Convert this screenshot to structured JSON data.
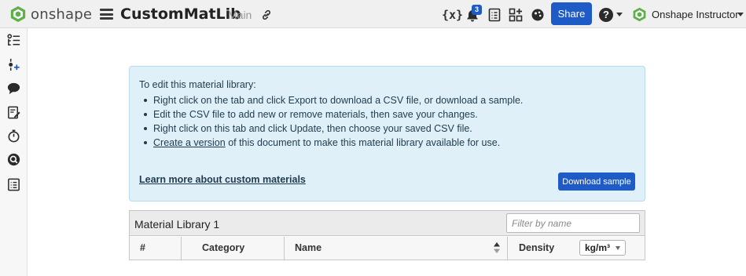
{
  "header": {
    "brand": "onshape",
    "document_title": "CustomMatLib",
    "branch": "Main",
    "variables_label": "{x}",
    "notification_count": "3",
    "share_label": "Share",
    "help_label": "?",
    "user_name": "Onshape Instructor",
    "icons": [
      "onshape-logo-icon",
      "hamburger-menu-icon",
      "link-icon",
      "variables-icon",
      "bell-icon",
      "tasks-icon",
      "app-store-icon",
      "graphics-icon",
      "help-icon",
      "caret-down-icon"
    ]
  },
  "sidebar": {
    "icons": [
      "features-list-icon",
      "insert-feature-icon",
      "comments-icon",
      "notes-icon",
      "timer-icon",
      "search-icon",
      "list-icon"
    ]
  },
  "info": {
    "heading": "To edit this material library:",
    "bullets": [
      "Right click on the tab and click Export to download a CSV file, or download a sample.",
      "Edit the CSV file to add new or remove materials, then save your changes.",
      "Right click on this tab and click Update, then choose your saved CSV file."
    ],
    "last_bullet_link": "Create a version",
    "last_bullet_rest": " of this document to make this material library available for use.",
    "learn_more": "Learn more about custom materials",
    "download_button": "Download sample"
  },
  "table": {
    "title": "Material Library 1",
    "filter_placeholder": "Filter by name",
    "columns": [
      "#",
      "Category",
      "Name",
      "Density"
    ],
    "density_unit": "kg/m³"
  },
  "colors": {
    "accent": "#1e5bc6",
    "info_background": "#dff0f9",
    "logo_green": "#4caf50"
  }
}
